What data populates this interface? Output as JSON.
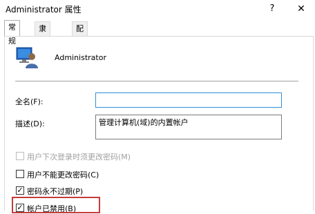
{
  "window": {
    "title": "Administrator 属性",
    "help_glyph": "?",
    "close_glyph": "✕"
  },
  "tabs": [
    {
      "label": "常规"
    },
    {
      "label": "隶属于"
    },
    {
      "label": "配置文件"
    }
  ],
  "user": {
    "name": "Administrator"
  },
  "fields": {
    "full_name": {
      "label": "全名(F):",
      "value": ""
    },
    "description": {
      "label": "描述(D):",
      "value": "管理计算机(域)的内置帐户"
    }
  },
  "checkboxes": [
    {
      "label": "用户下次登录时须更改密码(M)",
      "checked": false,
      "disabled": true
    },
    {
      "label": "用户不能更改密码(C)",
      "checked": false,
      "disabled": false
    },
    {
      "label": "密码永不过期(P)",
      "checked": true,
      "disabled": false
    },
    {
      "label": "帐户已禁用(B)",
      "checked": true,
      "disabled": false
    }
  ],
  "check_glyph": "✓",
  "colors": {
    "highlight": "#c63a3a",
    "focus": "#2f8ed8"
  }
}
